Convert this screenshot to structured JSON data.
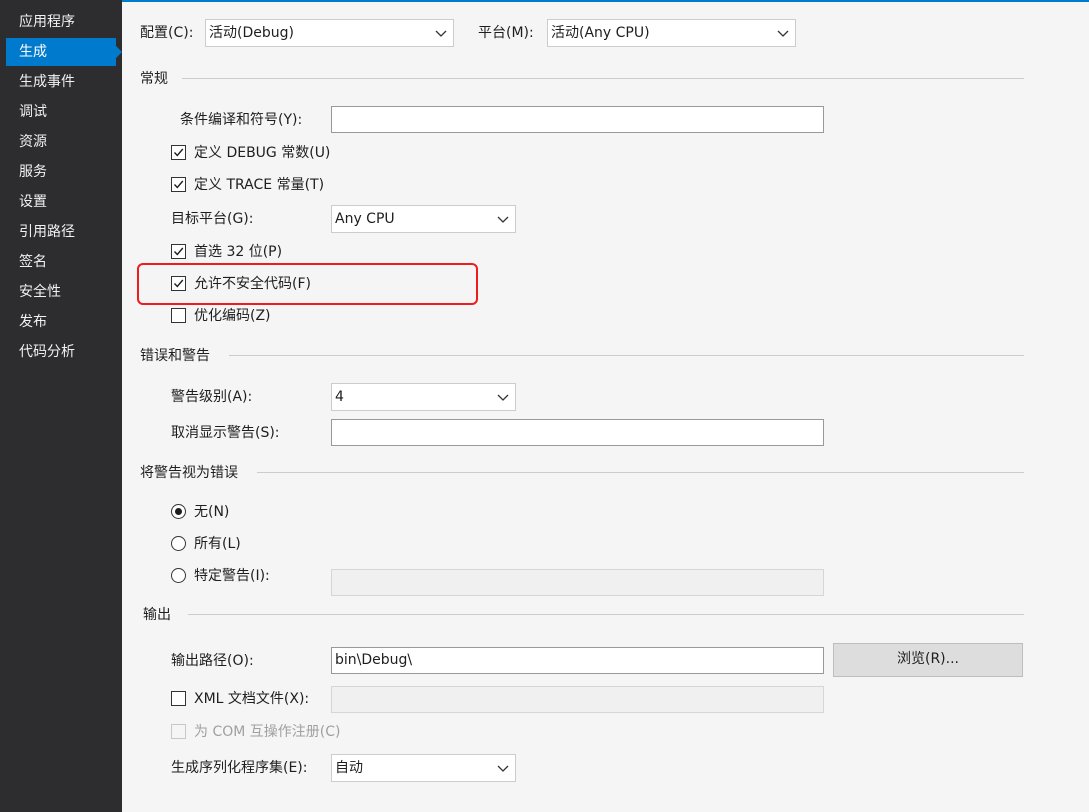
{
  "sidebar": {
    "items": [
      {
        "label": "应用程序"
      },
      {
        "label": "生成"
      },
      {
        "label": "生成事件"
      },
      {
        "label": "调试"
      },
      {
        "label": "资源"
      },
      {
        "label": "服务"
      },
      {
        "label": "设置"
      },
      {
        "label": "引用路径"
      },
      {
        "label": "签名"
      },
      {
        "label": "安全性"
      },
      {
        "label": "发布"
      },
      {
        "label": "代码分析"
      }
    ],
    "active_index": 1
  },
  "top": {
    "config_label": "配置(C):",
    "config_value": "活动(Debug)",
    "platform_label": "平台(M):",
    "platform_value": "活动(Any CPU)"
  },
  "general": {
    "title": "常规",
    "conditional_label": "条件编译和符号(Y):",
    "conditional_value": "",
    "define_debug_label": "定义 DEBUG 常数(U)",
    "define_debug_checked": true,
    "define_trace_label": "定义 TRACE 常量(T)",
    "define_trace_checked": true,
    "target_label": "目标平台(G):",
    "target_value": "Any CPU",
    "prefer32_label": "首选 32 位(P)",
    "prefer32_checked": true,
    "unsafe_label": "允许不安全代码(F)",
    "unsafe_checked": true,
    "optimize_label": "优化编码(Z)",
    "optimize_checked": false
  },
  "errors": {
    "title": "错误和警告",
    "warning_level_label": "警告级别(A):",
    "warning_level_value": "4",
    "suppress_label": "取消显示警告(S):",
    "suppress_value": ""
  },
  "treat": {
    "title": "将警告视为错误",
    "none_label": "无(N)",
    "all_label": "所有(L)",
    "specific_label": "特定警告(I):",
    "selected": "none",
    "specific_value": ""
  },
  "output": {
    "title": "输出",
    "path_label": "输出路径(O):",
    "path_value": "bin\\Debug\\",
    "browse_label": "浏览(R)...",
    "xml_label": "XML 文档文件(X):",
    "xml_checked": false,
    "xml_value": "",
    "com_label": "为 COM 互操作注册(C)",
    "com_checked": false,
    "serialization_label": "生成序列化程序集(E):",
    "serialization_value": "自动"
  },
  "colors": {
    "accent": "#007acc",
    "sidebar_bg": "#2d2d30",
    "highlight": "#ee1c1c"
  }
}
